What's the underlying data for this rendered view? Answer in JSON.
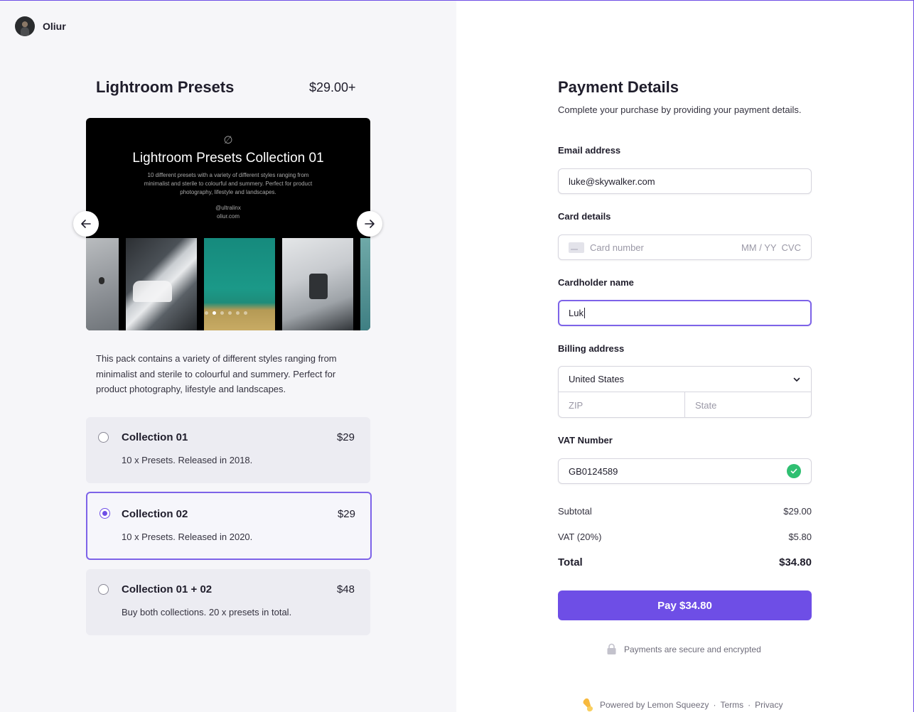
{
  "seller": {
    "name": "Oliur"
  },
  "product": {
    "title": "Lightroom Presets",
    "price": "$29.00+",
    "description": "This pack contains a variety of different styles ranging from minimalist and sterile to colourful and summery. Perfect for product photography, lifestyle and landscapes."
  },
  "carousel": {
    "logo_glyph": "∅",
    "title": "Lightroom Presets Collection 01",
    "description": "10 different presets with a variety of different styles ranging from minimalist and sterile to colourful and summery. Perfect for product photography, lifestyle and landscapes.",
    "handle": "@ultralinx",
    "site": "oliur.com",
    "prev_icon": "arrow-left-icon",
    "next_icon": "arrow-right-icon",
    "slide_count": 6,
    "active_slide": 2
  },
  "options": [
    {
      "name": "Collection 01",
      "price": "$29",
      "description": "10 x Presets. Released in 2018.",
      "selected": false
    },
    {
      "name": "Collection 02",
      "price": "$29",
      "description": "10 x Presets. Released in 2020.",
      "selected": true
    },
    {
      "name": "Collection 01 + 02",
      "price": "$48",
      "description": "Buy both collections. 20 x presets in total.",
      "selected": false
    }
  ],
  "payment": {
    "title": "Payment Details",
    "subtitle": "Complete your purchase by providing your payment details.",
    "email": {
      "label": "Email address",
      "value": "luke@skywalker.com"
    },
    "card": {
      "label": "Card details",
      "number_placeholder": "Card number",
      "expiry_cvc_placeholder": "MM / YY  CVC"
    },
    "cardholder": {
      "label": "Cardholder name",
      "value": "Luk"
    },
    "billing": {
      "label": "Billing address",
      "country": "United States",
      "zip_placeholder": "ZIP",
      "state_placeholder": "State"
    },
    "vat": {
      "label": "VAT Number",
      "value": "GB0124589",
      "valid": true
    },
    "summary": {
      "subtotal_label": "Subtotal",
      "subtotal": "$29.00",
      "vat_label": "VAT (20%)",
      "vat": "$5.80",
      "total_label": "Total",
      "total": "$34.80"
    },
    "pay_button": "Pay $34.80",
    "secure_note": "Payments are secure and encrypted"
  },
  "footer": {
    "powered_by": "Powered by Lemon Squeezy",
    "terms": "Terms",
    "privacy": "Privacy"
  },
  "colors": {
    "accent": "#6e4ee6",
    "success": "#2fbf71",
    "panel_bg": "#f6f6f9"
  }
}
